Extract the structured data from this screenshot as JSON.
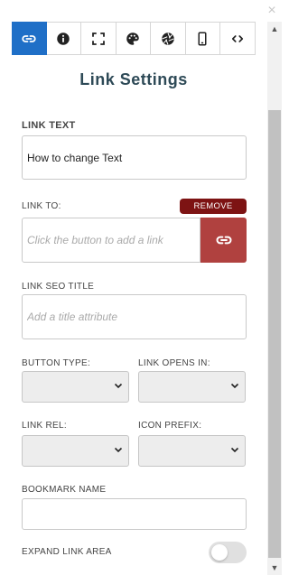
{
  "tabs": [
    {
      "icon": "link-icon",
      "active": true
    },
    {
      "icon": "info-icon",
      "active": false
    },
    {
      "icon": "fullscreen-icon",
      "active": false
    },
    {
      "icon": "palette-icon",
      "active": false
    },
    {
      "icon": "aperture-icon",
      "active": false
    },
    {
      "icon": "mobile-icon",
      "active": false
    },
    {
      "icon": "code-icon",
      "active": false
    }
  ],
  "panel": {
    "title": "Link Settings",
    "close_symbol": "×"
  },
  "link_text": {
    "label": "LINK TEXT",
    "value": "How to change Text"
  },
  "link_to": {
    "label": "LINK TO:",
    "remove_label": "REMOVE",
    "placeholder": "Click the button to add a link",
    "value": ""
  },
  "seo_title": {
    "label": "LINK SEO TITLE",
    "placeholder": "Add a title attribute",
    "value": ""
  },
  "button_type": {
    "label": "BUTTON TYPE:",
    "selected": ""
  },
  "link_opens_in": {
    "label": "LINK OPENS IN:",
    "selected": ""
  },
  "link_rel": {
    "label": "LINK REL:",
    "selected": ""
  },
  "icon_prefix": {
    "label": "ICON PREFIX:",
    "selected": ""
  },
  "bookmark": {
    "label": "BOOKMARK NAME",
    "value": ""
  },
  "expand_area": {
    "label": "EXPAND LINK AREA",
    "enabled": false
  },
  "colors": {
    "accent_blue": "#1f6fc7",
    "remove_red": "#7d1313",
    "link_button_red": "#b0413f",
    "title_color": "#2e4a57"
  }
}
